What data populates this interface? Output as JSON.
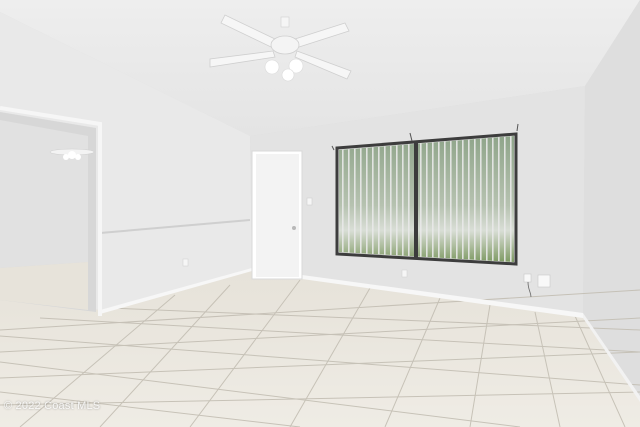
{
  "watermark": "© 2022 Coast MLS",
  "colors": {
    "ceiling": "#ececec",
    "wall_left": "#e8e8e8",
    "wall_back": "#e3e3e3",
    "wall_right": "#dcdcdc",
    "floor": "#e9e5dc",
    "grout": "#bdb8ad",
    "baseboard": "#f6f6f6",
    "door": "#f3f3f3",
    "window_frame": "#404040"
  },
  "icons": [
    "ceiling-fan-icon",
    "ceiling-fan-icon"
  ]
}
